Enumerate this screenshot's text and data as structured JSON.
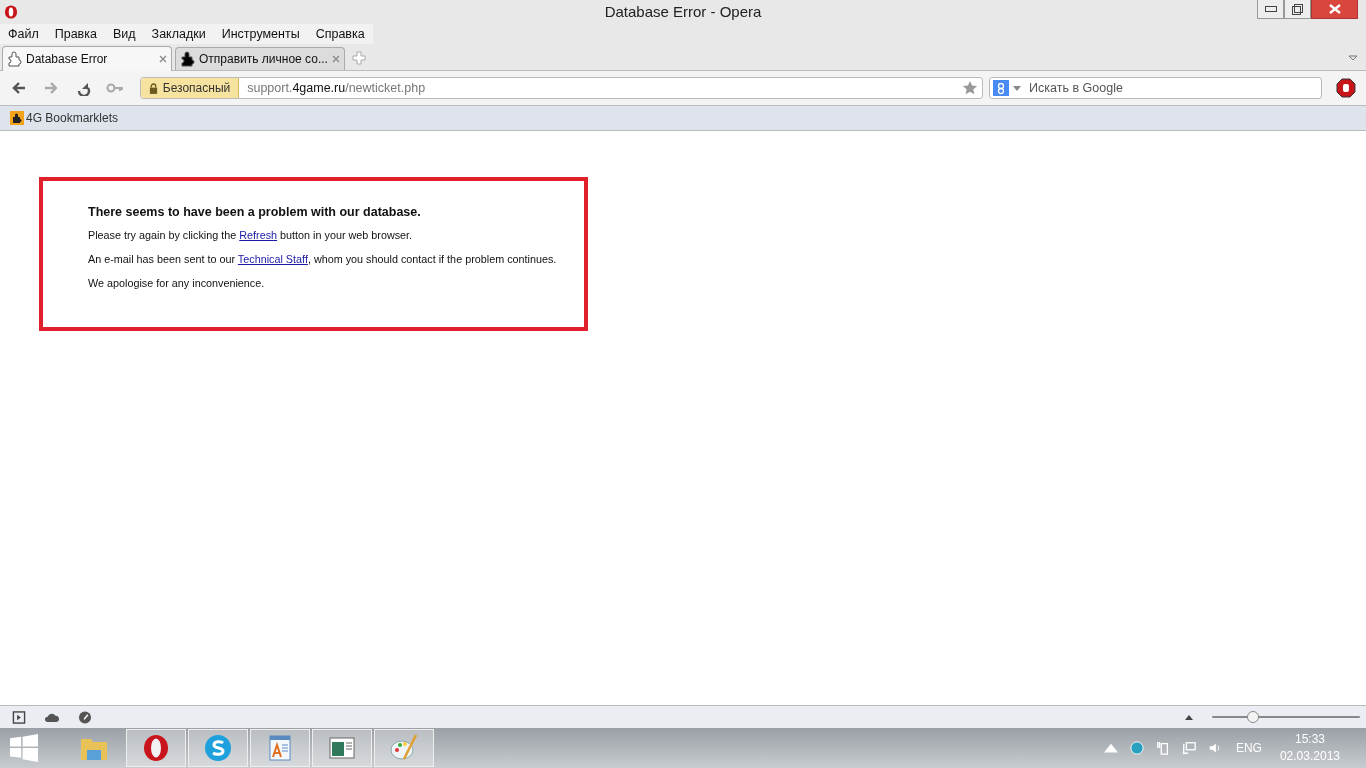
{
  "window": {
    "title": "Database Error - Opera"
  },
  "menu": [
    "Файл",
    "Правка",
    "Вид",
    "Закладки",
    "Инструменты",
    "Справка"
  ],
  "tabs": [
    {
      "label": "Database Error",
      "selected": true
    },
    {
      "label": "Отправить личное со...",
      "selected": false
    }
  ],
  "address": {
    "security": "Безопасный",
    "url_start": "support.",
    "url_domain": "4game.ru",
    "url_rest": "/newticket.php"
  },
  "search": {
    "placeholder": "Искать в Google"
  },
  "bookmarks": [
    "4G Bookmarklets"
  ],
  "error": {
    "heading": "There seems to have been a problem with our database.",
    "paragraphs": [
      [
        {
          "kind": "text",
          "text": "Please try again by clicking the "
        },
        {
          "kind": "link",
          "text": "Refresh"
        },
        {
          "kind": "text",
          "text": " button in your web browser."
        }
      ],
      [
        {
          "kind": "text",
          "text": "An e-mail has been sent to our "
        },
        {
          "kind": "link",
          "text": "Technical Staff"
        },
        {
          "kind": "text",
          "text": ", whom you should contact if the problem continues."
        }
      ],
      [
        {
          "kind": "text",
          "text": "We apologise for any inconvenience."
        }
      ]
    ]
  },
  "zoom": {
    "level": 0.28
  },
  "taskbar": {
    "apps": [
      {
        "kind": "folder",
        "running": false
      },
      {
        "kind": "opera",
        "running": true
      },
      {
        "kind": "skype",
        "running": true
      },
      {
        "kind": "wordpad",
        "running": true
      },
      {
        "kind": "window",
        "running": true
      },
      {
        "kind": "paint",
        "running": true
      }
    ],
    "language": "ENG",
    "time": "15:33",
    "date": "02.03.2013"
  }
}
